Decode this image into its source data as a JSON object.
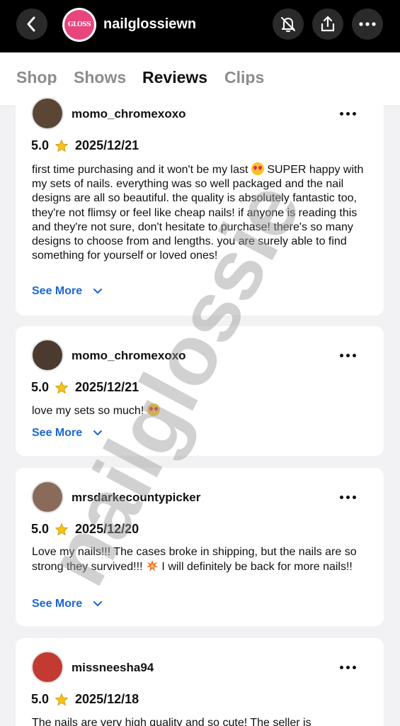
{
  "header": {
    "shop_name": "nailglossiewn",
    "avatar_text": "GLOSS"
  },
  "tabs": [
    {
      "label": "Shop"
    },
    {
      "label": "Shows"
    },
    {
      "label": "Reviews"
    },
    {
      "label": "Clips"
    }
  ],
  "reviews": [
    {
      "user": "momo_chromexoxo",
      "rating": "5.0",
      "date": "2025/12/21",
      "text_before_emoji": "first time purchasing and it won't be my last",
      "text_after_emoji": "SUPER happy with my sets of nails. everything was so well packaged and the nail designs are all so beautiful. the quality is absolutely fantastic too, they're not flimsy or feel like cheap nails! if anyone is reading this and they're not sure, don't hesitate to purchase! there's so many designs to choose from and lengths. you are surely able to find something for yourself or loved ones!",
      "see_more": "See More"
    },
    {
      "user": "momo_chromexoxo",
      "rating": "5.0",
      "date": "2025/12/21",
      "text_before_emoji": "love my sets so much!",
      "text_after_emoji": "",
      "see_more": "See More"
    },
    {
      "user": "mrsdarkecountypicker",
      "rating": "5.0",
      "date": "2025/12/20",
      "text_before_emoji": "Love my nails!!! The cases broke in shipping, but the nails are so strong they survived!!!",
      "text_after_emoji": "I will definitely be back for more nails!!",
      "see_more": "See More"
    },
    {
      "user": "missneesha94",
      "rating": "5.0",
      "date": "2025/12/18",
      "text_before_emoji": "The nails are very high quality and so cute! The seller is",
      "text_after_emoji": "",
      "see_more": ""
    }
  ],
  "watermark": "nailglossie",
  "colors": {
    "link": "#1a67d2",
    "star": "#f6c417",
    "topbar": "#000000"
  },
  "icons": [
    "back-arrow-icon",
    "bell-off-icon",
    "share-icon",
    "more-icon",
    "star-icon",
    "heart-eyes-emoji-icon",
    "collision-emoji-icon",
    "chevron-down-icon"
  ]
}
